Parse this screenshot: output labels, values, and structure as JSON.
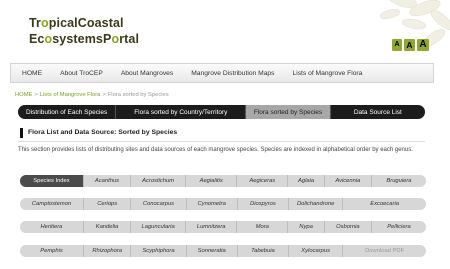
{
  "header": {
    "logo_line1_a": "Tr",
    "logo_line1_b": "o",
    "logo_line1_c": "picalCoastal",
    "logo_line2_a": "Ec",
    "logo_line2_b": "o",
    "logo_line2_c": "systemsP",
    "logo_line2_d": "o",
    "logo_line2_e": "rtal",
    "font_sizes": [
      "A",
      "A",
      "A"
    ]
  },
  "nav": [
    "HOME",
    "About TroCEP",
    "About Mangroves",
    "Mangrove Distribution Maps",
    "Lists of Mangrove Flora"
  ],
  "breadcrumb": {
    "home": "HOME",
    "sep1": ">",
    "parent": "Lists of Mangrove Flora",
    "sep2": ">",
    "current": "Flora sorted by Species"
  },
  "tabs": [
    "Distribution of Each Species",
    "Flora sorted by Country/Territory",
    "Flora sorted by Species",
    "Data Source List"
  ],
  "section": {
    "title": "Flora List and Data Source: Sorted by Species",
    "description": "This section provides lists of distributing sites and data sources of each mangrove species. Species are indexed in alphabetical order by each genus."
  },
  "species_rows": [
    [
      "Species Index",
      "Acanthus",
      "Acrostichum",
      "Aegialitis",
      "Aegiceras",
      "Aglaia",
      "Avicennia",
      "Bruguiera"
    ],
    [
      "Camptostemon",
      "Ceriops",
      "Conocarpus",
      "Cynometra",
      "Diospyros",
      "Dolichandrone",
      "Excoecaria"
    ],
    [
      "Heritiera",
      "Kandelia",
      "Laguncularia",
      "Lumnitzera",
      "Mora",
      "Nypa",
      "Osbornia",
      "Pelliciera"
    ],
    [
      "Pemphis",
      "Rhizophora",
      "Scyphiphora",
      "Sonneratia",
      "Tabebuia",
      "Xylocarpus",
      "Download PDF"
    ]
  ],
  "colors": {
    "accent_green": "#8aa322",
    "tab_bar": "#1c1c1c",
    "active_tab": "#a7a7a7",
    "index_cell": "#4b4b4b"
  }
}
